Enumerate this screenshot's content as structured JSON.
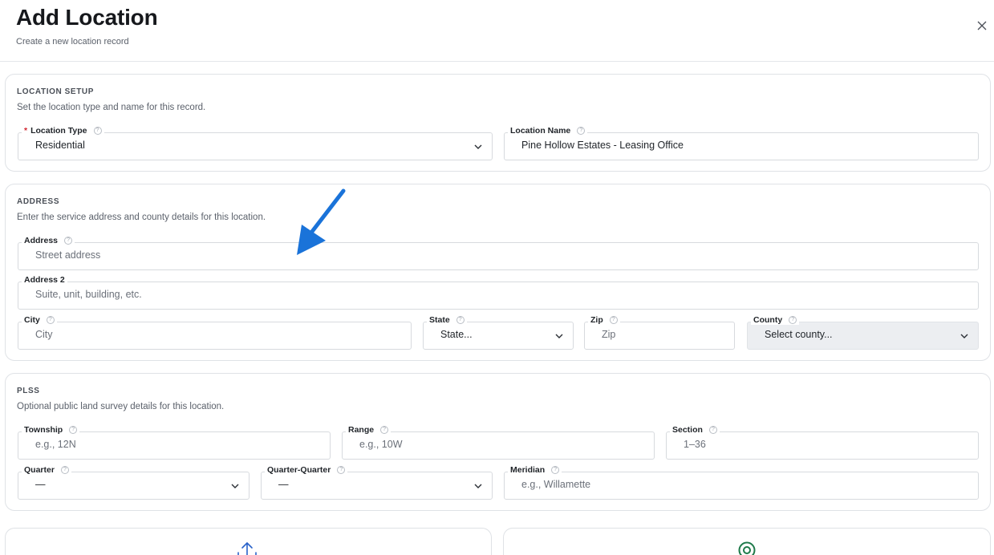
{
  "header": {
    "title": "Add Location",
    "subtitle": "Create a new location record",
    "close_icon": "close-icon"
  },
  "colors": {
    "required": "#d1242f",
    "arrow_annotation": "#1a73d9",
    "disabled_bg": "#eceef1"
  },
  "location_setup": {
    "title": "LOCATION SETUP",
    "description": "Set the location type and name for this record.",
    "location_type": {
      "label": "Location Type",
      "required_mark": "*",
      "value": "Residential"
    },
    "location_name": {
      "label": "Location Name",
      "value": "Pine Hollow Estates - Leasing Office"
    }
  },
  "address": {
    "title": "ADDRESS",
    "description": "Enter the service address and county details for this location.",
    "address1": {
      "label": "Address",
      "placeholder": "Street address"
    },
    "address2": {
      "label": "Address 2",
      "placeholder": "Suite, unit, building, etc."
    },
    "city": {
      "label": "City",
      "placeholder": "City"
    },
    "state": {
      "label": "State",
      "value": "State..."
    },
    "zip": {
      "label": "Zip",
      "placeholder": "Zip"
    },
    "county": {
      "label": "County",
      "value": "Select county..."
    }
  },
  "plss": {
    "title": "PLSS",
    "description": "Optional public land survey details for this location.",
    "township": {
      "label": "Township",
      "placeholder": "e.g., 12N"
    },
    "range": {
      "label": "Range",
      "placeholder": "e.g., 10W"
    },
    "section": {
      "label": "Section",
      "placeholder": "1–36"
    },
    "quarter": {
      "label": "Quarter",
      "value": "—"
    },
    "quarter_quarter": {
      "label": "Quarter-Quarter",
      "value": "—"
    },
    "meridian": {
      "label": "Meridian",
      "placeholder": "e.g., Willamette"
    }
  },
  "help_glyph": "?",
  "bottom_cards": {
    "left_icon": "upload-arrow-icon",
    "right_icon": "location-target-icon"
  }
}
